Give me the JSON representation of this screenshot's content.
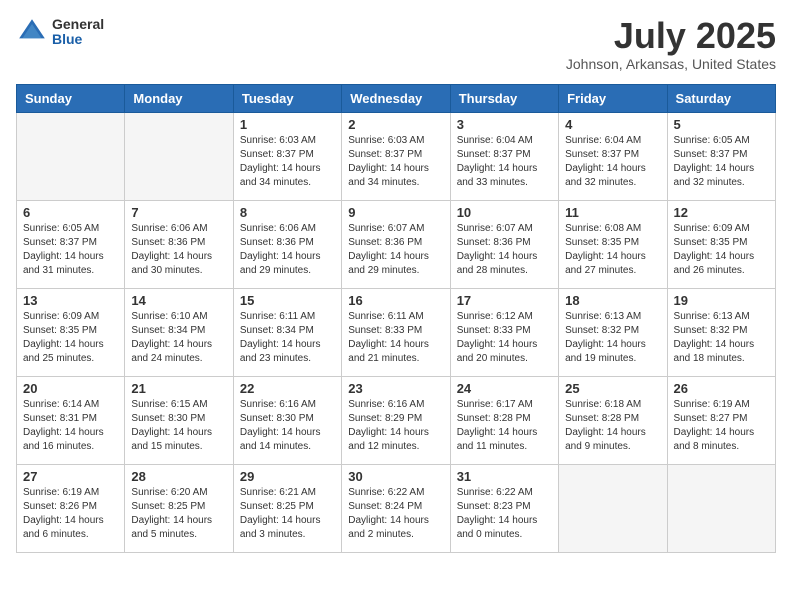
{
  "logo": {
    "general": "General",
    "blue": "Blue"
  },
  "title": "July 2025",
  "location": "Johnson, Arkansas, United States",
  "days_of_week": [
    "Sunday",
    "Monday",
    "Tuesday",
    "Wednesday",
    "Thursday",
    "Friday",
    "Saturday"
  ],
  "weeks": [
    [
      {
        "day": "",
        "empty": true
      },
      {
        "day": "",
        "empty": true
      },
      {
        "day": "1",
        "sunrise": "Sunrise: 6:03 AM",
        "sunset": "Sunset: 8:37 PM",
        "daylight": "Daylight: 14 hours and 34 minutes."
      },
      {
        "day": "2",
        "sunrise": "Sunrise: 6:03 AM",
        "sunset": "Sunset: 8:37 PM",
        "daylight": "Daylight: 14 hours and 34 minutes."
      },
      {
        "day": "3",
        "sunrise": "Sunrise: 6:04 AM",
        "sunset": "Sunset: 8:37 PM",
        "daylight": "Daylight: 14 hours and 33 minutes."
      },
      {
        "day": "4",
        "sunrise": "Sunrise: 6:04 AM",
        "sunset": "Sunset: 8:37 PM",
        "daylight": "Daylight: 14 hours and 32 minutes."
      },
      {
        "day": "5",
        "sunrise": "Sunrise: 6:05 AM",
        "sunset": "Sunset: 8:37 PM",
        "daylight": "Daylight: 14 hours and 32 minutes."
      }
    ],
    [
      {
        "day": "6",
        "sunrise": "Sunrise: 6:05 AM",
        "sunset": "Sunset: 8:37 PM",
        "daylight": "Daylight: 14 hours and 31 minutes."
      },
      {
        "day": "7",
        "sunrise": "Sunrise: 6:06 AM",
        "sunset": "Sunset: 8:36 PM",
        "daylight": "Daylight: 14 hours and 30 minutes."
      },
      {
        "day": "8",
        "sunrise": "Sunrise: 6:06 AM",
        "sunset": "Sunset: 8:36 PM",
        "daylight": "Daylight: 14 hours and 29 minutes."
      },
      {
        "day": "9",
        "sunrise": "Sunrise: 6:07 AM",
        "sunset": "Sunset: 8:36 PM",
        "daylight": "Daylight: 14 hours and 29 minutes."
      },
      {
        "day": "10",
        "sunrise": "Sunrise: 6:07 AM",
        "sunset": "Sunset: 8:36 PM",
        "daylight": "Daylight: 14 hours and 28 minutes."
      },
      {
        "day": "11",
        "sunrise": "Sunrise: 6:08 AM",
        "sunset": "Sunset: 8:35 PM",
        "daylight": "Daylight: 14 hours and 27 minutes."
      },
      {
        "day": "12",
        "sunrise": "Sunrise: 6:09 AM",
        "sunset": "Sunset: 8:35 PM",
        "daylight": "Daylight: 14 hours and 26 minutes."
      }
    ],
    [
      {
        "day": "13",
        "sunrise": "Sunrise: 6:09 AM",
        "sunset": "Sunset: 8:35 PM",
        "daylight": "Daylight: 14 hours and 25 minutes."
      },
      {
        "day": "14",
        "sunrise": "Sunrise: 6:10 AM",
        "sunset": "Sunset: 8:34 PM",
        "daylight": "Daylight: 14 hours and 24 minutes."
      },
      {
        "day": "15",
        "sunrise": "Sunrise: 6:11 AM",
        "sunset": "Sunset: 8:34 PM",
        "daylight": "Daylight: 14 hours and 23 minutes."
      },
      {
        "day": "16",
        "sunrise": "Sunrise: 6:11 AM",
        "sunset": "Sunset: 8:33 PM",
        "daylight": "Daylight: 14 hours and 21 minutes."
      },
      {
        "day": "17",
        "sunrise": "Sunrise: 6:12 AM",
        "sunset": "Sunset: 8:33 PM",
        "daylight": "Daylight: 14 hours and 20 minutes."
      },
      {
        "day": "18",
        "sunrise": "Sunrise: 6:13 AM",
        "sunset": "Sunset: 8:32 PM",
        "daylight": "Daylight: 14 hours and 19 minutes."
      },
      {
        "day": "19",
        "sunrise": "Sunrise: 6:13 AM",
        "sunset": "Sunset: 8:32 PM",
        "daylight": "Daylight: 14 hours and 18 minutes."
      }
    ],
    [
      {
        "day": "20",
        "sunrise": "Sunrise: 6:14 AM",
        "sunset": "Sunset: 8:31 PM",
        "daylight": "Daylight: 14 hours and 16 minutes."
      },
      {
        "day": "21",
        "sunrise": "Sunrise: 6:15 AM",
        "sunset": "Sunset: 8:30 PM",
        "daylight": "Daylight: 14 hours and 15 minutes."
      },
      {
        "day": "22",
        "sunrise": "Sunrise: 6:16 AM",
        "sunset": "Sunset: 8:30 PM",
        "daylight": "Daylight: 14 hours and 14 minutes."
      },
      {
        "day": "23",
        "sunrise": "Sunrise: 6:16 AM",
        "sunset": "Sunset: 8:29 PM",
        "daylight": "Daylight: 14 hours and 12 minutes."
      },
      {
        "day": "24",
        "sunrise": "Sunrise: 6:17 AM",
        "sunset": "Sunset: 8:28 PM",
        "daylight": "Daylight: 14 hours and 11 minutes."
      },
      {
        "day": "25",
        "sunrise": "Sunrise: 6:18 AM",
        "sunset": "Sunset: 8:28 PM",
        "daylight": "Daylight: 14 hours and 9 minutes."
      },
      {
        "day": "26",
        "sunrise": "Sunrise: 6:19 AM",
        "sunset": "Sunset: 8:27 PM",
        "daylight": "Daylight: 14 hours and 8 minutes."
      }
    ],
    [
      {
        "day": "27",
        "sunrise": "Sunrise: 6:19 AM",
        "sunset": "Sunset: 8:26 PM",
        "daylight": "Daylight: 14 hours and 6 minutes."
      },
      {
        "day": "28",
        "sunrise": "Sunrise: 6:20 AM",
        "sunset": "Sunset: 8:25 PM",
        "daylight": "Daylight: 14 hours and 5 minutes."
      },
      {
        "day": "29",
        "sunrise": "Sunrise: 6:21 AM",
        "sunset": "Sunset: 8:25 PM",
        "daylight": "Daylight: 14 hours and 3 minutes."
      },
      {
        "day": "30",
        "sunrise": "Sunrise: 6:22 AM",
        "sunset": "Sunset: 8:24 PM",
        "daylight": "Daylight: 14 hours and 2 minutes."
      },
      {
        "day": "31",
        "sunrise": "Sunrise: 6:22 AM",
        "sunset": "Sunset: 8:23 PM",
        "daylight": "Daylight: 14 hours and 0 minutes."
      },
      {
        "day": "",
        "empty": true
      },
      {
        "day": "",
        "empty": true
      }
    ]
  ]
}
